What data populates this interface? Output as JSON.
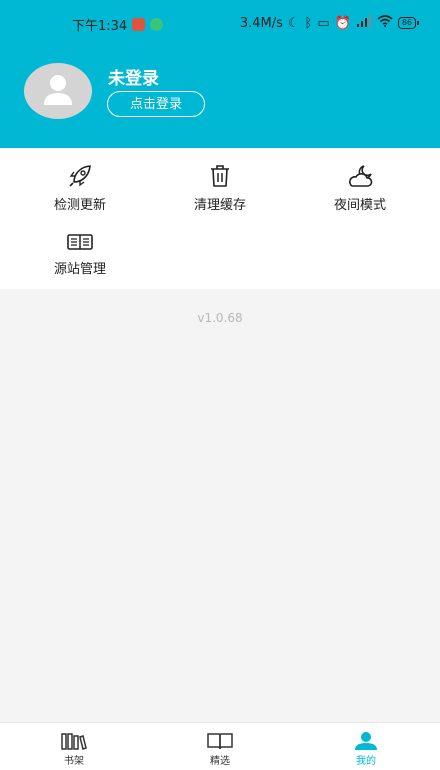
{
  "status_bar": {
    "time": "下午1:34",
    "speed": "3.4M/s",
    "battery": "86"
  },
  "profile": {
    "username": "未登录",
    "login_button": "点击登录"
  },
  "menu": {
    "items": [
      {
        "label": "检测更新",
        "icon": "rocket-icon"
      },
      {
        "label": "清理缓存",
        "icon": "trash-icon"
      },
      {
        "label": "夜间模式",
        "icon": "moon-cloud-icon"
      },
      {
        "label": "源站管理",
        "icon": "book-icon"
      }
    ]
  },
  "version": "v1.0.68",
  "tabbar": {
    "tabs": [
      {
        "label": "书架",
        "icon": "bookshelf-icon"
      },
      {
        "label": "精选",
        "icon": "open-book-icon"
      },
      {
        "label": "我的",
        "icon": "user-icon",
        "active": true
      }
    ]
  },
  "colors": {
    "accent": "#00b8d4",
    "background": "#f4f4f4"
  }
}
